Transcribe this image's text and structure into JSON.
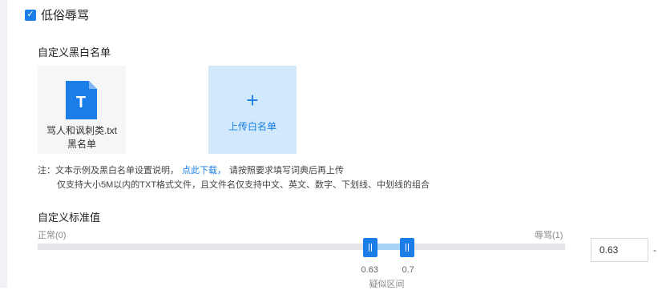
{
  "section": {
    "title": "低俗辱骂",
    "checked": true
  },
  "blacklist": {
    "label": "自定义黑白名单",
    "file": {
      "name": "骂人和讽刺类.txt",
      "type": "黑名单",
      "icon_letter": "T"
    },
    "upload": {
      "plus": "+",
      "label": "上传白名单"
    }
  },
  "notes": {
    "prefix": "注：文本示例及黑白名单设置说明，",
    "link": "点此下载，",
    "suffix": "请按照要求填写词典后再上传",
    "line2": "仅支持大小5M以内的TXT格式文件，且文件名仅支持中文、英文、数字、下划线、中划线的组合"
  },
  "threshold": {
    "label": "自定义标准值",
    "min_label": "正常(0)",
    "max_label": "辱骂(1)",
    "low": 0.63,
    "high": 0.7,
    "low_text": "0.63",
    "high_text": "0.7",
    "interval_label": "疑似区间",
    "input_value": "0.63",
    "dash": "-"
  },
  "colors": {
    "accent": "#1a7de8",
    "range_fill": "#a8d4f8",
    "track": "#e4e6ea",
    "upload_bg": "#d1e9fb"
  }
}
